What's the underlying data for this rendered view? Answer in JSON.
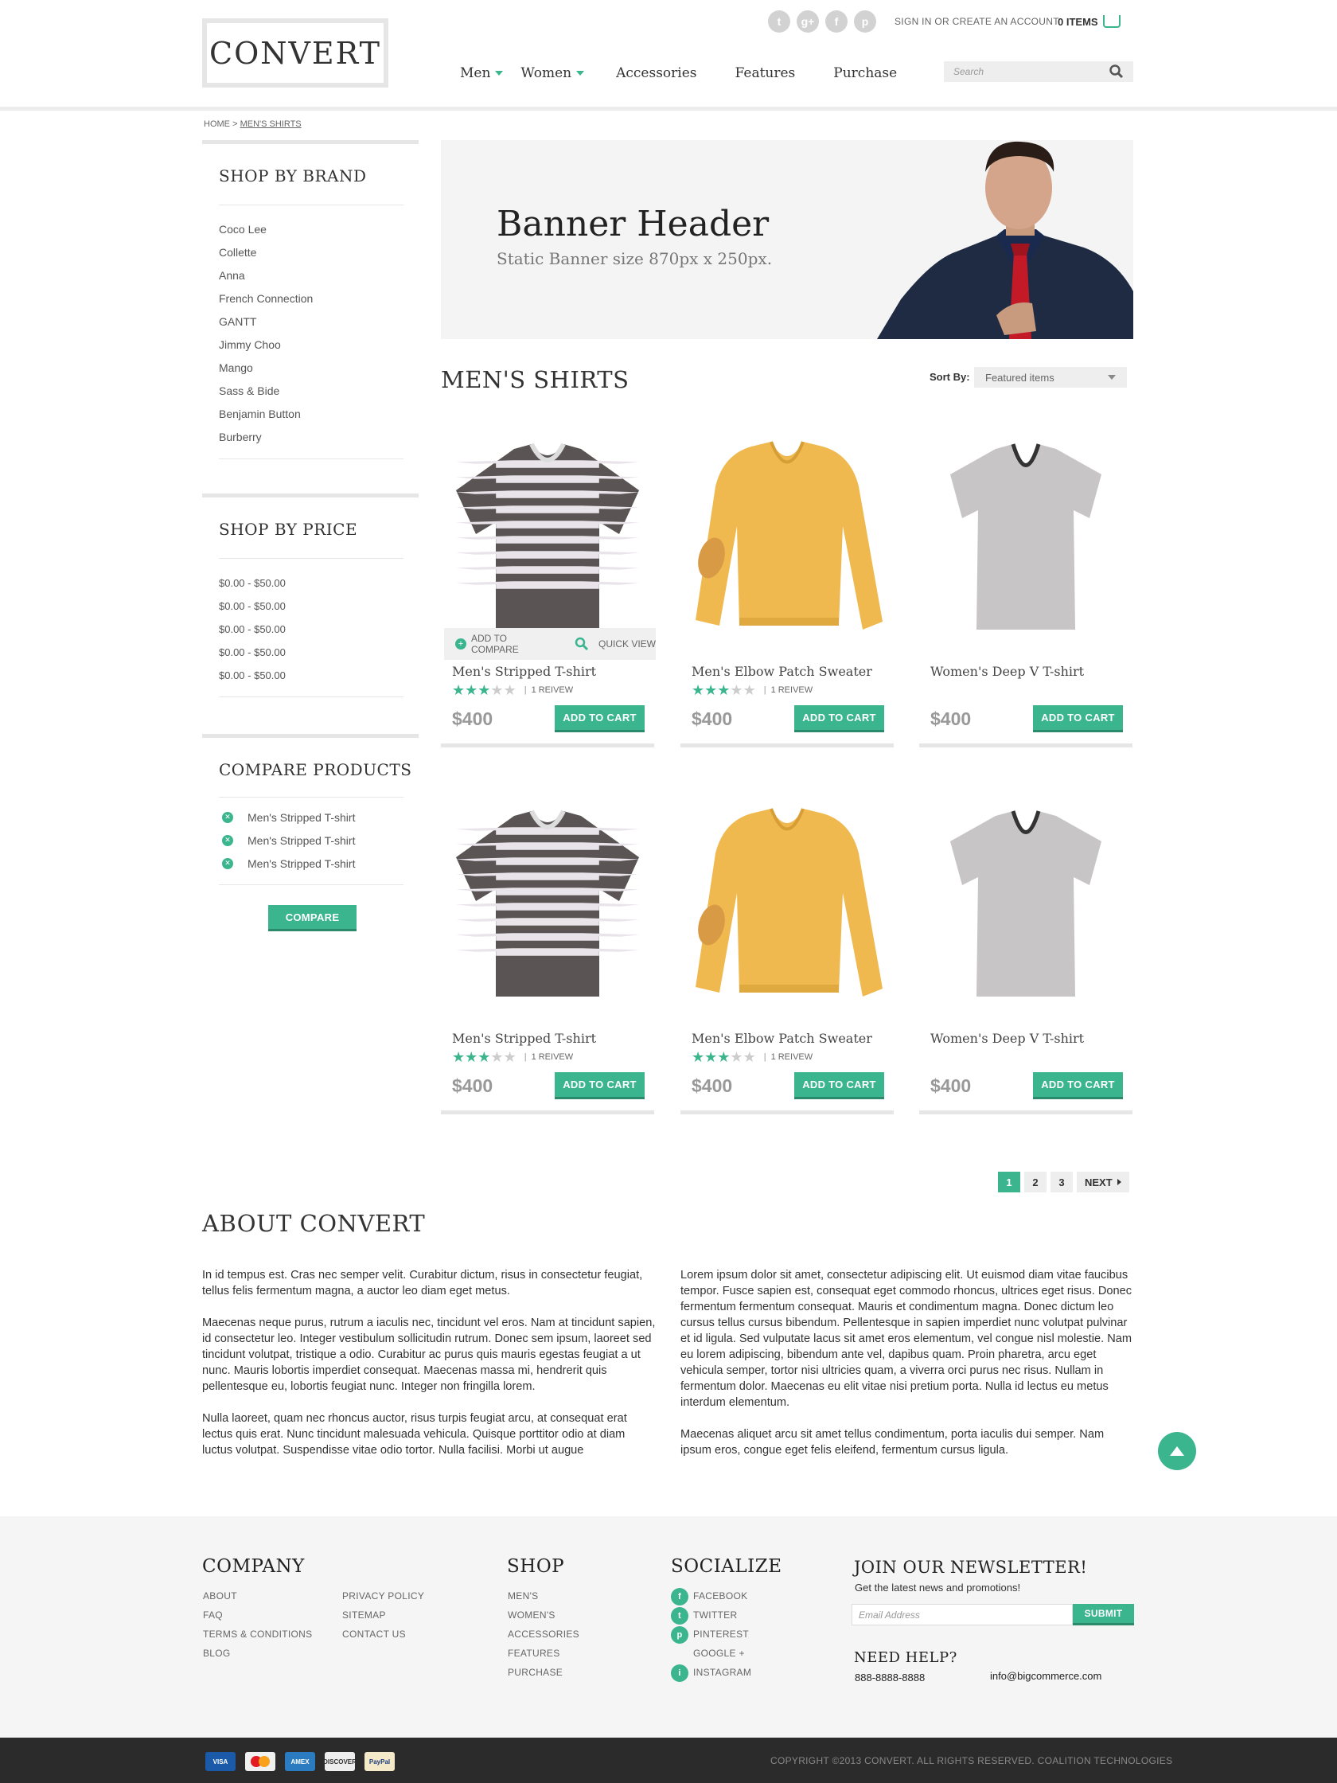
{
  "brand": "CONVERT",
  "header": {
    "social_icons": [
      "twitter-icon",
      "google-plus-icon",
      "facebook-icon",
      "pinterest-icon"
    ],
    "signin": "SIGN IN OR CREATE AN ACCOUNT",
    "cart_count": "0 ITEMS",
    "search_placeholder": "Search",
    "nav": [
      {
        "label": "Men",
        "dropdown": true
      },
      {
        "label": "Women",
        "dropdown": true
      },
      {
        "label": "Accessories",
        "dropdown": false
      },
      {
        "label": "Features",
        "dropdown": false
      },
      {
        "label": "Purchase",
        "dropdown": false
      }
    ]
  },
  "breadcrumb": {
    "home": "HOME",
    "sep": ">",
    "current": "MEN'S SHIRTS"
  },
  "sidebar": {
    "brand_title": "SHOP BY BRAND",
    "brands": [
      "Coco Lee",
      "Collette",
      "Anna",
      "French Connection",
      "GANTT",
      "Jimmy Choo",
      "Mango",
      "Sass & Bide",
      "Benjamin Button",
      "Burberry"
    ],
    "price_title": "SHOP BY PRICE",
    "prices": [
      "$0.00 - $50.00",
      "$0.00 - $50.00",
      "$0.00 - $50.00",
      "$0.00 - $50.00",
      "$0.00 - $50.00"
    ],
    "compare_title": "COMPARE PRODUCTS",
    "compare_items": [
      "Men's Stripped T-shirt",
      "Men's Stripped T-shirt",
      "Men's Stripped T-shirt"
    ],
    "compare_button": "COMPARE"
  },
  "banner": {
    "title": "Banner Header",
    "subtitle": "Static Banner size 870px x 250px."
  },
  "section": {
    "title": "MEN'S SHIRTS",
    "sort_label": "Sort By:",
    "sort_value": "Featured items"
  },
  "compare_bar": {
    "add": "ADD TO COMPARE",
    "quick": "QUICK VIEW"
  },
  "products": [
    {
      "name": "Men's Stripped T-shirt",
      "rating": 3,
      "reviews": "1 REIVEW",
      "price": "$400",
      "cta": "ADD TO CART",
      "kind": "striped"
    },
    {
      "name": "Men's Elbow Patch Sweater",
      "rating": 3,
      "reviews": "1 REIVEW",
      "price": "$400",
      "cta": "ADD TO CART",
      "kind": "sweater"
    },
    {
      "name": "Women's Deep V T-shirt",
      "rating": 0,
      "reviews": "",
      "price": "$400",
      "cta": "ADD TO CART",
      "kind": "grey"
    },
    {
      "name": "Men's Stripped T-shirt",
      "rating": 3,
      "reviews": "1 REIVEW",
      "price": "$400",
      "cta": "ADD TO CART",
      "kind": "striped"
    },
    {
      "name": "Men's Elbow Patch Sweater",
      "rating": 3,
      "reviews": "1 REIVEW",
      "price": "$400",
      "cta": "ADD TO CART",
      "kind": "sweater"
    },
    {
      "name": "Women's Deep V T-shirt",
      "rating": 0,
      "reviews": "",
      "price": "$400",
      "cta": "ADD TO CART",
      "kind": "grey"
    }
  ],
  "pagination": {
    "pages": [
      "1",
      "2",
      "3"
    ],
    "next": "NEXT",
    "current": "1"
  },
  "about": {
    "title": "ABOUT CONVERT",
    "left": [
      "In id tempus est. Cras nec semper velit. Curabitur dictum, risus in consectetur feugiat, tellus felis fermentum magna, a auctor leo diam eget metus.",
      "Maecenas neque purus, rutrum a iaculis nec, tincidunt vel eros. Nam at tincidunt sapien, id consectetur leo. Integer vestibulum sollicitudin rutrum. Donec sem ipsum, laoreet sed tincidunt volutpat, tristique a odio. Curabitur ac purus quis mauris egestas feugiat a ut nunc. Mauris lobortis imperdiet consequat. Maecenas massa mi, hendrerit quis pellentesque eu, lobortis feugiat nunc. Integer non fringilla lorem.",
      "Nulla laoreet, quam nec rhoncus auctor, risus turpis feugiat arcu, at consequat erat lectus quis erat. Nunc tincidunt malesuada vehicula. Quisque porttitor odio at diam luctus volutpat. Suspendisse vitae odio tortor. Nulla facilisi. Morbi ut augue"
    ],
    "right": [
      "Lorem ipsum dolor sit amet, consectetur adipiscing elit. Ut euismod diam vitae faucibus tempor. Fusce sapien est, consequat eget commodo rhoncus, ultrices eget risus. Donec fermentum fermentum consequat. Mauris et condimentum magna. Donec dictum leo cursus tellus cursus bibendum. Pellentesque in sapien imperdiet nunc volutpat pulvinar et id ligula. Sed vulputate lacus sit amet eros elementum, vel congue nisl molestie. Nam eu lorem adipiscing, bibendum ante vel, dapibus quam. Proin pharetra, arcu eget vehicula semper, tortor nisi ultricies quam, a viverra orci purus nec risus. Nullam in fermentum dolor. Maecenas eu elit vitae nisi pretium porta. Nulla id lectus eu metus interdum elementum.",
      "Maecenas aliquet arcu sit amet tellus condimentum, porta iaculis dui semper. Nam ipsum eros, congue eget felis eleifend, fermentum cursus ligula."
    ]
  },
  "footer": {
    "company_title": "COMPANY",
    "company_col1": [
      "ABOUT",
      "FAQ",
      "TERMS & CONDITIONS",
      "BLOG"
    ],
    "company_col2": [
      "PRIVACY POLICY",
      "SITEMAP",
      "CONTACT US"
    ],
    "shop_title": "SHOP",
    "shop": [
      "MEN'S",
      "WOMEN'S",
      "ACCESSORIES",
      "FEATURES",
      "PURCHASE"
    ],
    "social_title": "SOCIALIZE",
    "social": [
      "FACEBOOK",
      "TWITTER",
      "PINTEREST",
      "GOOGLE +",
      "INSTAGRAM"
    ],
    "newsletter_title": "JOIN OUR NEWSLETTER!",
    "newsletter_sub": "Get the latest news and promotions!",
    "email_placeholder": "Email Address",
    "submit": "SUBMIT",
    "help_title": "NEED HELP?",
    "phone": "888-8888-8888",
    "email": "info@bigcommerce.com"
  },
  "payments": [
    "VISA",
    "MasterCard",
    "AMERICAN EXPRESS",
    "DISCOVER",
    "PayPal"
  ],
  "copyright": "COPYRIGHT ©2013 CONVERT.  ALL RIGHTS RESERVED. COALITION TECHNOLOGIES",
  "colors": {
    "accent": "#3bb58e",
    "footer_bg": "#f5f5f5",
    "bottom_bar": "#2b2b2b"
  }
}
